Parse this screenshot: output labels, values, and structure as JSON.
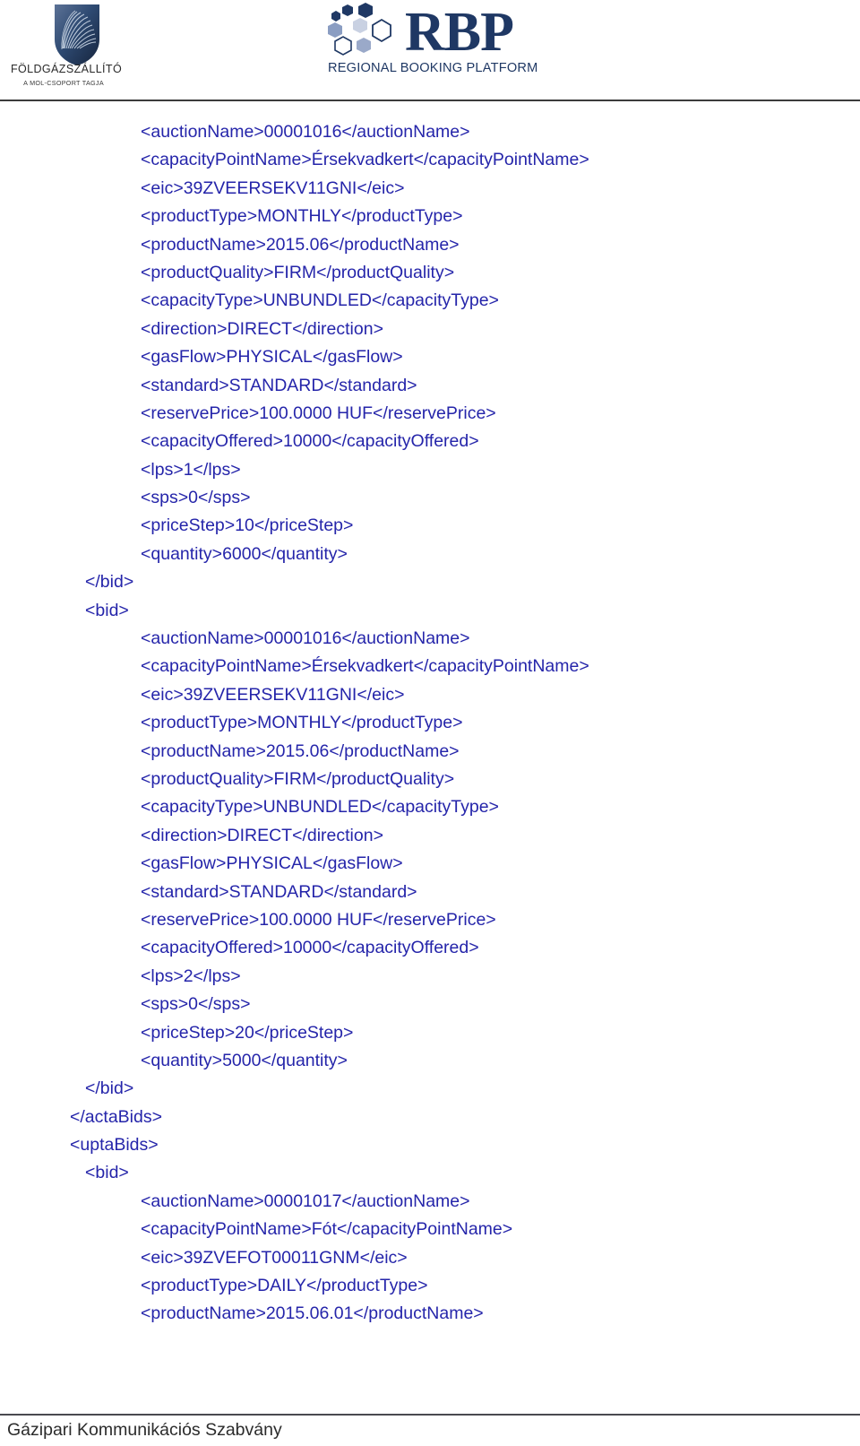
{
  "header": {
    "fgsz_logo": {
      "name": "FÖLDGÁZSZÁLLÍTÓ",
      "subtitle": "A MOL-CSOPORT TAGJA",
      "icon": "shield-fan-icon"
    },
    "rbp_logo": {
      "letters": "RBP",
      "tagline_parts": [
        "R",
        "EGIONAL ",
        "B",
        "OOKING ",
        "P",
        "LATFORM"
      ],
      "tagline": "REGIONAL BOOKING PLATFORM",
      "icon": "hexagon-cluster-icon"
    },
    "colors": {
      "brand_navy": "#1f3864",
      "hex_dark": "#1f3864",
      "hex_mid": "#8095bd",
      "hex_light": "#c8cfe0",
      "rule": "#3b3b3b"
    }
  },
  "document": {
    "code_color": "#2525aa",
    "lines": [
      {
        "indent": 2,
        "text": "<auctionName>00001016</auctionName>"
      },
      {
        "indent": 2,
        "text": "<capacityPointName>Érsekvadkert</capacityPointName>"
      },
      {
        "indent": 2,
        "text": "<eic>39ZVEERSEKV11GNI</eic>"
      },
      {
        "indent": 2,
        "text": "<productType>MONTHLY</productType>"
      },
      {
        "indent": 2,
        "text": "<productName>2015.06</productName>"
      },
      {
        "indent": 2,
        "text": "<productQuality>FIRM</productQuality>"
      },
      {
        "indent": 2,
        "text": "<capacityType>UNBUNDLED</capacityType>"
      },
      {
        "indent": 2,
        "text": "<direction>DIRECT</direction>"
      },
      {
        "indent": 2,
        "text": "<gasFlow>PHYSICAL</gasFlow>"
      },
      {
        "indent": 2,
        "text": "<standard>STANDARD</standard>"
      },
      {
        "indent": 2,
        "text": "<reservePrice>100.0000 HUF</reservePrice>"
      },
      {
        "indent": 2,
        "text": "<capacityOffered>10000</capacityOffered>"
      },
      {
        "indent": 2,
        "text": "<lps>1</lps>"
      },
      {
        "indent": 2,
        "text": "<sps>0</sps>"
      },
      {
        "indent": 2,
        "text": "<priceStep>10</priceStep>"
      },
      {
        "indent": 2,
        "text": "<quantity>6000</quantity>"
      },
      {
        "indent": 1,
        "text": "</bid>"
      },
      {
        "indent": 1,
        "text": "<bid>"
      },
      {
        "indent": 2,
        "text": "<auctionName>00001016</auctionName>"
      },
      {
        "indent": 2,
        "text": "<capacityPointName>Érsekvadkert</capacityPointName>"
      },
      {
        "indent": 2,
        "text": "<eic>39ZVEERSEKV11GNI</eic>"
      },
      {
        "indent": 2,
        "text": "<productType>MONTHLY</productType>"
      },
      {
        "indent": 2,
        "text": "<productName>2015.06</productName>"
      },
      {
        "indent": 2,
        "text": "<productQuality>FIRM</productQuality>"
      },
      {
        "indent": 2,
        "text": "<capacityType>UNBUNDLED</capacityType>"
      },
      {
        "indent": 2,
        "text": "<direction>DIRECT</direction>"
      },
      {
        "indent": 2,
        "text": "<gasFlow>PHYSICAL</gasFlow>"
      },
      {
        "indent": 2,
        "text": "<standard>STANDARD</standard>"
      },
      {
        "indent": 2,
        "text": "<reservePrice>100.0000 HUF</reservePrice>"
      },
      {
        "indent": 2,
        "text": "<capacityOffered>10000</capacityOffered>"
      },
      {
        "indent": 2,
        "text": "<lps>2</lps>"
      },
      {
        "indent": 2,
        "text": "<sps>0</sps>"
      },
      {
        "indent": 2,
        "text": "<priceStep>20</priceStep>"
      },
      {
        "indent": 2,
        "text": "<quantity>5000</quantity>"
      },
      {
        "indent": 1,
        "text": "</bid>"
      },
      {
        "indent": 0,
        "text": "</actaBids>"
      },
      {
        "indent": 0,
        "text": "<uptaBids>"
      },
      {
        "indent": 1,
        "text": "<bid>"
      },
      {
        "indent": 2,
        "text": "<auctionName>00001017</auctionName>"
      },
      {
        "indent": 2,
        "text": "<capacityPointName>Fót</capacityPointName>"
      },
      {
        "indent": 2,
        "text": "<eic>39ZVEFOT00011GNM</eic>"
      },
      {
        "indent": 2,
        "text": "<productType>DAILY</productType>"
      },
      {
        "indent": 2,
        "text": "<productName>2015.06.01</productName>"
      }
    ]
  },
  "footer": {
    "text": "Gázipari Kommunikációs Szabvány"
  }
}
